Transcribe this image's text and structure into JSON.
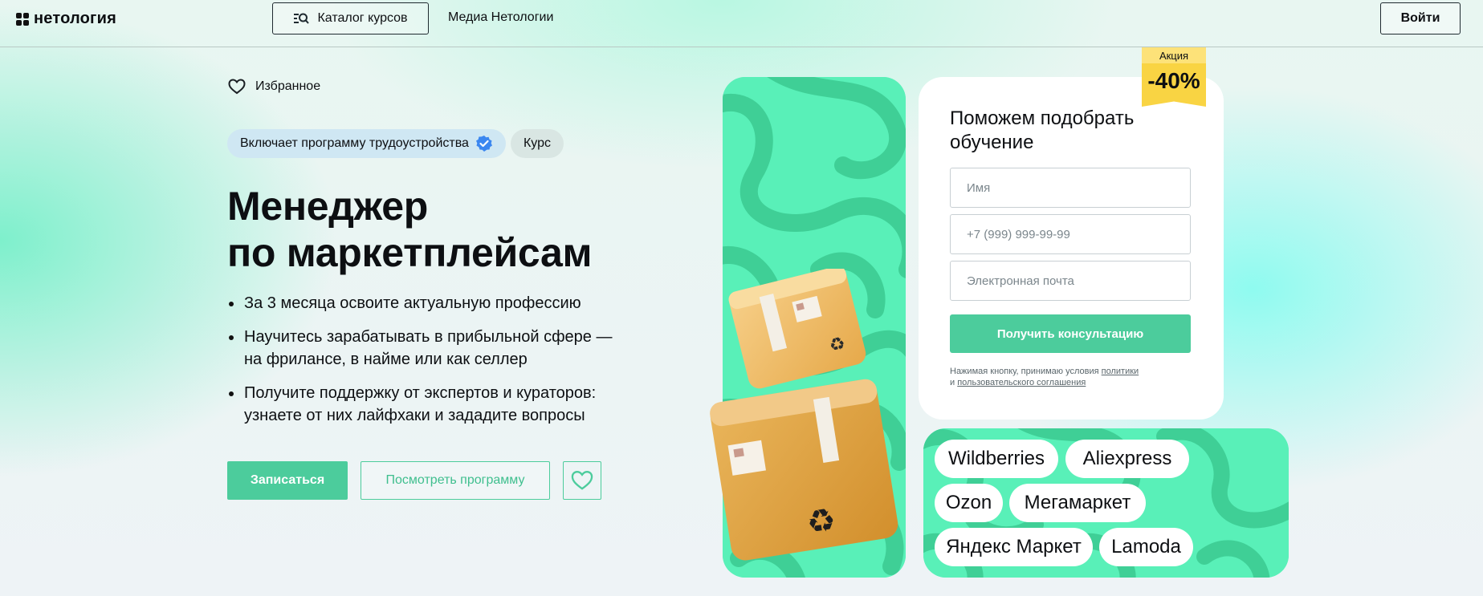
{
  "header": {
    "logo_text": "нетология",
    "catalog_label": "Каталог курсов",
    "media_label": "Медиа Нетологии",
    "login_label": "Войти"
  },
  "hero": {
    "favorite_label": "Избранное",
    "badge_job": "Включает программу трудоустройства",
    "badge_type": "Курс",
    "title_line1": "Менеджер",
    "title_line2": "по маркетплейсам",
    "bullets": [
      "За 3 месяца освоите актуальную профессию",
      "Научитесь зарабатывать в прибыльной сфере — на фрилансе, в найме или как селлер",
      "Получите поддержку от экспертов и кураторов: узнаете от них лайфхаки и зададите вопросы"
    ],
    "enroll_label": "Записаться",
    "program_label": "Посмотреть программу"
  },
  "promo": {
    "label": "Акция",
    "discount": "-40%"
  },
  "form": {
    "title": "Поможем подобрать обучение",
    "name_placeholder": "Имя",
    "phone_placeholder": "+7 (999) 999-99-99",
    "email_placeholder": "Электронная почта",
    "submit_label": "Получить консультацию",
    "consent_prefix": "Нажимая кнопку, принимаю условия",
    "consent_link1": "политики",
    "consent_and": "и",
    "consent_link2": "пользовательского соглашения"
  },
  "marketplaces": [
    "Wildberries",
    "Aliexpress",
    "Ozon",
    "Мегамаркет",
    "Яндекс Маркет",
    "Lamoda"
  ],
  "colors": {
    "accent_green": "#4ccc9c",
    "pattern_light": "#59f0b8",
    "pattern_dark": "#3fcf96",
    "promo_yellow": "#f9d443"
  }
}
